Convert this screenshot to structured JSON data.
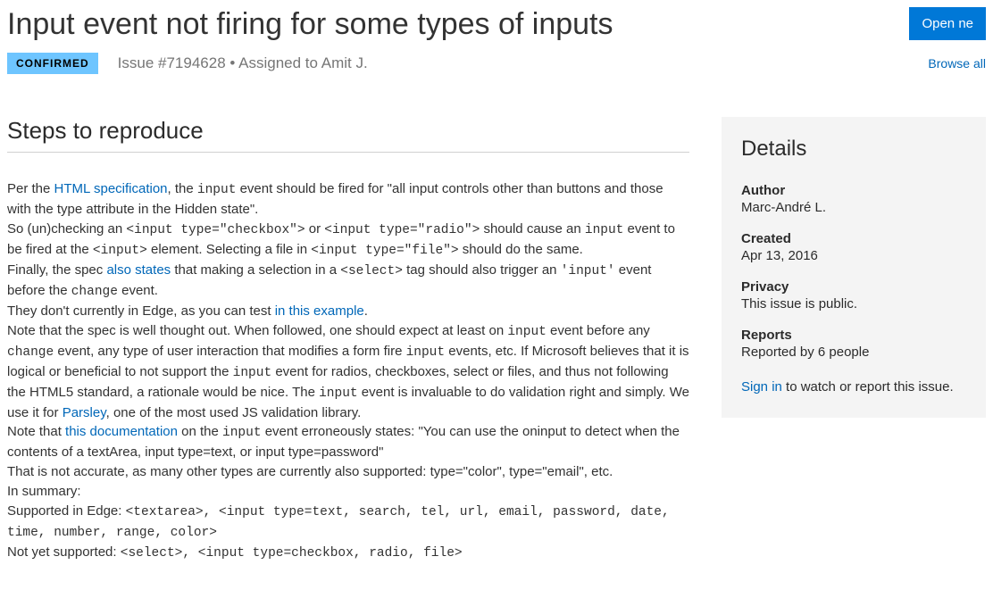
{
  "header": {
    "title": "Input event not firing for some types of inputs",
    "open_button": "Open ne",
    "badge": "CONFIRMED",
    "issue_meta": "Issue #7194628 • Assigned to Amit J.",
    "browse_all": "Browse all"
  },
  "steps": {
    "heading": "Steps to reproduce",
    "p1_a": "Per the ",
    "p1_link1": "HTML specification",
    "p1_b": ", the ",
    "p1_code1": "input",
    "p1_c": " event should be fired for \"all input controls other than buttons and those with the type attribute in the Hidden state\".",
    "p2_a": "So (un)checking an ",
    "p2_code1": "<input type=\"checkbox\">",
    "p2_b": " or ",
    "p2_code2": "<input type=\"radio\">",
    "p2_c": " should cause an ",
    "p2_code3": "input",
    "p2_d": " event to be fired at the ",
    "p2_code4": "<input>",
    "p2_e": " element. Selecting a file in ",
    "p2_code5": "<input type=\"file\">",
    "p2_f": " should do the same.",
    "p3_a": "Finally, the spec ",
    "p3_link1": "also states",
    "p3_b": " that making a selection in a ",
    "p3_code1": "<select>",
    "p3_c": " tag should also trigger an ",
    "p3_code2": "'input'",
    "p3_d": " event before the ",
    "p3_code3": "change",
    "p3_e": " event.",
    "p4_a": "They don't currently in Edge, as you can test ",
    "p4_link1": "in this example",
    "p4_b": ".",
    "p5_a": "Note that the spec is well thought out. When followed, one should expect at least on ",
    "p5_code1": "input",
    "p5_b": " event before any ",
    "p5_code2": "change",
    "p5_c": " event, any type of user interaction that modifies a form fire ",
    "p5_code3": "input",
    "p5_d": " events, etc. If Microsoft believes that it is logical or beneficial to not support the ",
    "p5_code4": "input",
    "p5_e": " event for radios, checkboxes, select or files, and thus not following the HTML5 standard, a rationale would be nice. The ",
    "p5_code5": "input",
    "p5_f": " event is invaluable to do validation right and simply. We use it for ",
    "p5_link1": "Parsley",
    "p5_g": ", one of the most used JS validation library.",
    "p6_a": "Note that ",
    "p6_link1": "this documentation",
    "p6_b": " on the ",
    "p6_code1": "input",
    "p6_c": " event erroneously states: \"You can use the oninput to detect when the contents of a textArea, input type=text, or input type=password\"",
    "p7": "That is not accurate, as many other types are currently also supported: type=\"color\", type=\"email\", etc.",
    "p8": "In summary:",
    "p9_a": "Supported in Edge: ",
    "p9_code": "<textarea>, <input type=text, search, tel, url, email, password, date, time, number, range, color>",
    "p10_a": "Not yet supported: ",
    "p10_code": "<select>, <input type=checkbox, radio, file>"
  },
  "details": {
    "heading": "Details",
    "author_label": "Author",
    "author_value": "Marc-André L.",
    "created_label": "Created",
    "created_value": "Apr 13, 2016",
    "privacy_label": "Privacy",
    "privacy_value": "This issue is public.",
    "reports_label": "Reports",
    "reports_value": "Reported by 6 people",
    "signin": "Sign in",
    "signin_tail": " to watch or report this issue."
  }
}
